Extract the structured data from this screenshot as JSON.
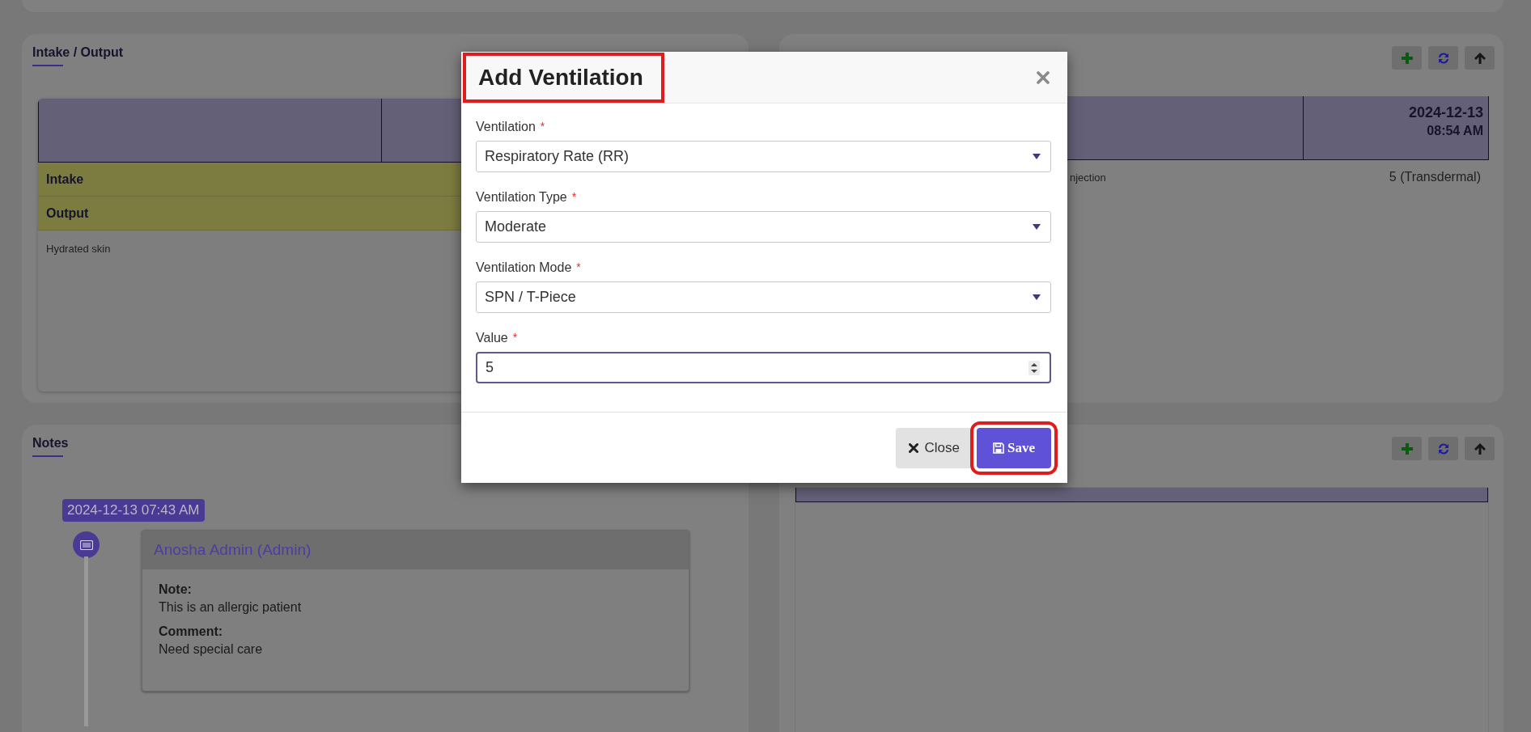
{
  "intake_output": {
    "title": "Intake / Output",
    "rows": [
      {
        "label": "Intake"
      },
      {
        "label": "Output"
      }
    ],
    "note": "Hydrated skin"
  },
  "medication": {
    "header_date": "2024-12-13",
    "header_time": "08:54 AM",
    "row": {
      "name": "njection",
      "dose": "5 (Transdermal)"
    }
  },
  "notes": {
    "title": "Notes",
    "entries": [
      {
        "timestamp": "2024-12-13 07:43 AM",
        "author": "Anosha Admin (Admin)",
        "fields": [
          {
            "label": "Note:",
            "text": "This is an allergic patient"
          },
          {
            "label": "Comment:",
            "text": "Need special care"
          }
        ]
      }
    ]
  },
  "modal": {
    "title": "Add Ventilation",
    "title_highlighted": true,
    "fields": [
      {
        "kind": "select",
        "label": "Ventilation",
        "required_mark": "*",
        "value": "Respiratory Rate (RR)",
        "focused": false
      },
      {
        "kind": "select",
        "label": "Ventilation Type",
        "required_mark": "*",
        "value": "Moderate",
        "focused": false
      },
      {
        "kind": "select",
        "label": "Ventilation Mode",
        "required_mark": "*",
        "value": "SPN / T-Piece",
        "focused": false
      },
      {
        "kind": "number",
        "label": "Value",
        "required_mark": "*",
        "value": "5",
        "focused": true
      }
    ],
    "buttons": [
      {
        "kind": "close",
        "label": "Close",
        "highlighted": false
      },
      {
        "kind": "save",
        "label": "Save",
        "highlighted": true
      }
    ]
  }
}
